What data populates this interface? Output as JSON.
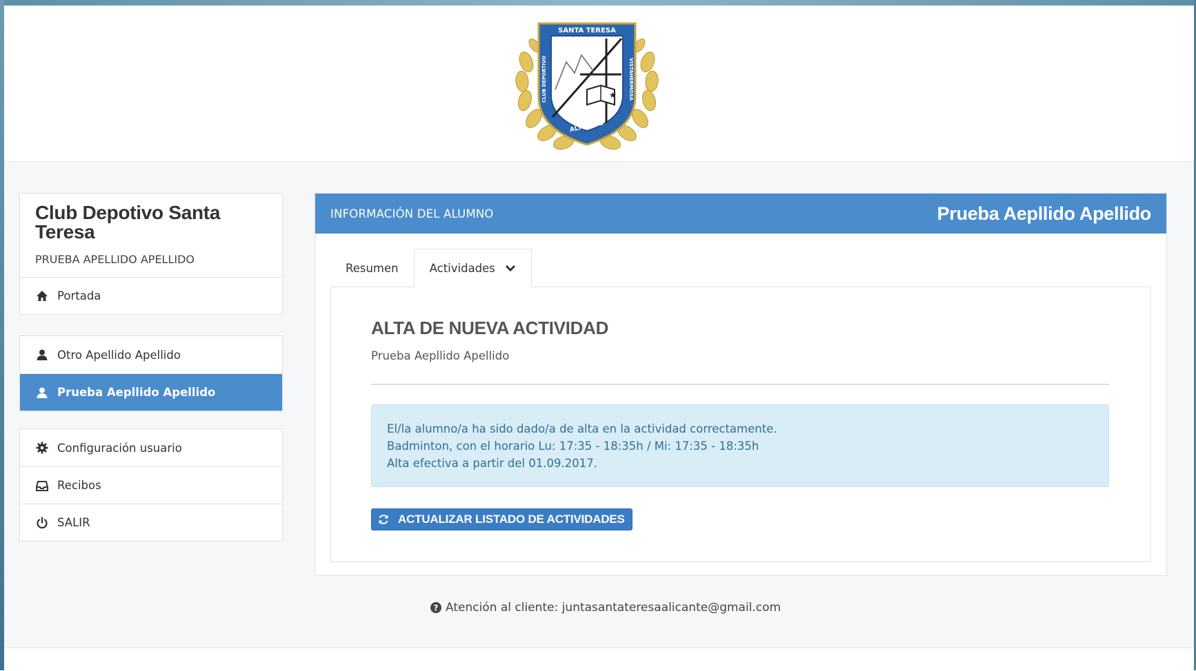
{
  "brand": {
    "logo_top_text": "SANTA TERESA",
    "logo_left_text": "CLUB DEPORTIVO",
    "logo_right_text": "VISTAHERMOSA",
    "logo_bottom_text": "ALICANTE",
    "accent_color": "#4a8ccc"
  },
  "sidebar": {
    "club_name": "Club Depotivo Santa Teresa",
    "user_name": "PRUEBA APELLIDO APELLIDO",
    "home": {
      "label": "Portada",
      "icon": "home-icon"
    },
    "students": [
      {
        "label": "Otro Apellido Apellido",
        "icon": "user-icon",
        "active": false
      },
      {
        "label": "Prueba Aepllido Apellido",
        "icon": "user-icon",
        "active": true
      }
    ],
    "config": [
      {
        "label": "Configuración usuario",
        "icon": "gear-icon"
      },
      {
        "label": "Recibos",
        "icon": "inbox-icon"
      },
      {
        "label": "SALIR",
        "icon": "power-icon"
      }
    ]
  },
  "panel": {
    "header_label": "INFORMACIÓN DEL ALUMNO",
    "student_name": "Prueba Aepllido Apellido",
    "tabs": [
      {
        "label": "Resumen",
        "active": false
      },
      {
        "label": "Actividades",
        "active": true,
        "dropdown": true
      }
    ],
    "section_title": "ALTA DE NUEVA ACTIVIDAD",
    "section_subtitle": "Prueba Aepllido Apellido",
    "alert_lines": [
      "El/la alumno/a ha sido dado/a de alta en la actividad correctamente.",
      "Badminton, con el horario Lu: 17:35 - 18:35h / Mi: 17:35 - 18:35h",
      "Alta efectiva a partir del 01.09.2017."
    ],
    "refresh_button": "ACTUALIZAR LISTADO DE ACTIVIDADES"
  },
  "contact": {
    "label": "Atención al cliente: juntasantateresaalicante@gmail.com"
  }
}
